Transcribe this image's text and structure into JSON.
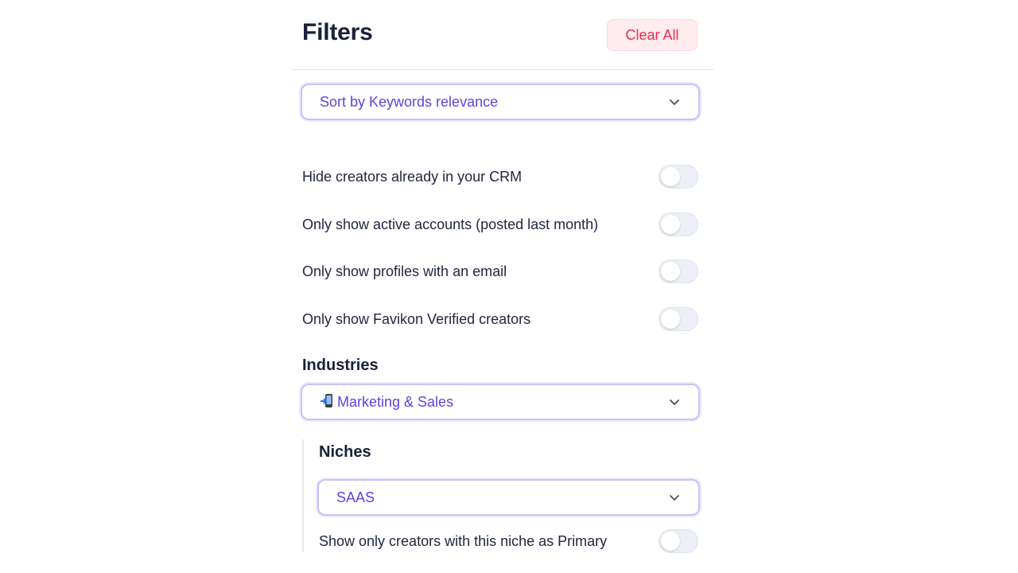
{
  "header": {
    "title": "Filters",
    "clear_label": "Clear All"
  },
  "sort": {
    "selected": "Sort by Keywords relevance"
  },
  "toggles": [
    {
      "label": "Hide creators already in your CRM",
      "on": false
    },
    {
      "label": "Only show active accounts (posted last month)",
      "on": false
    },
    {
      "label": "Only show profiles with an email",
      "on": false
    },
    {
      "label": "Only show Favikon Verified creators",
      "on": false
    }
  ],
  "industries": {
    "label": "Industries",
    "icon": "mobile-phone-arrow-icon",
    "selected": "Marketing & Sales"
  },
  "niches": {
    "label": "Niches",
    "selected": "SAAS",
    "primary_toggle_label": "Show only creators with this niche as Primary",
    "primary_toggle_on": false
  },
  "colors": {
    "accent": "#5a45e0",
    "danger": "#ee2d4f",
    "border": "#c7c2f5"
  }
}
